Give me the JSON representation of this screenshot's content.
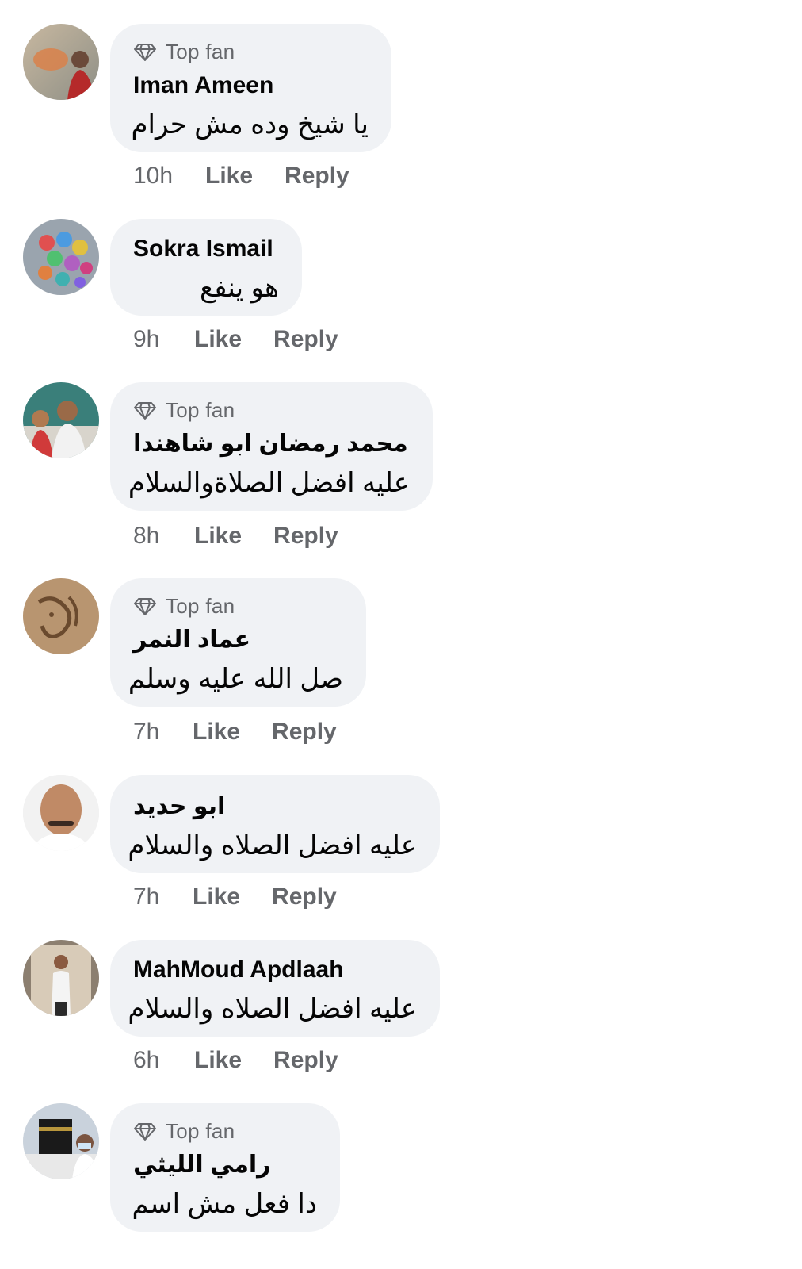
{
  "comments": [
    {
      "badge": "Top fan",
      "author": "Iman Ameen",
      "text": "يا شيخ وده مش حرام",
      "time": "10h",
      "like": "Like",
      "reply": "Reply"
    },
    {
      "badge": "",
      "author": "Sokra Ismail",
      "text": "هو ينفع",
      "time": "9h",
      "like": "Like",
      "reply": "Reply"
    },
    {
      "badge": "Top fan",
      "author": "محمد رمضان ابو شاهندا",
      "text": "عليه افضل الصلاةوالسلام",
      "time": "8h",
      "like": "Like",
      "reply": "Reply"
    },
    {
      "badge": "Top fan",
      "author": "عماد النمر",
      "text": "صل الله عليه وسلم",
      "time": "7h",
      "like": "Like",
      "reply": "Reply"
    },
    {
      "badge": "",
      "author": "ابو حديد",
      "text": "عليه افضل الصلاه والسلام",
      "time": "7h",
      "like": "Like",
      "reply": "Reply"
    },
    {
      "badge": "",
      "author": "MahMoud Apdlaah",
      "text": "عليه افضل الصلاه والسلام",
      "time": "6h",
      "like": "Like",
      "reply": "Reply"
    },
    {
      "badge": "Top fan",
      "author": "رامي الليثي",
      "text": "دا فعل مش اسم",
      "time": "",
      "like": "",
      "reply": ""
    }
  ],
  "icons": {
    "badge_icon": "diamond-icon"
  },
  "colors": {
    "bubble_bg": "#f0f2f5",
    "secondary_text": "#65676b",
    "primary_text": "#050505"
  }
}
